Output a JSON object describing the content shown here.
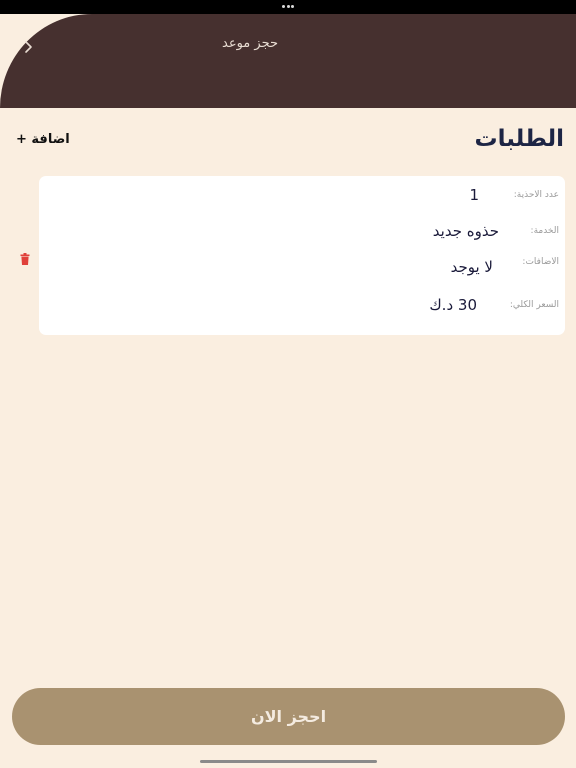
{
  "header": {
    "title": "حجز موعد",
    "back_icon": "chevron-right-icon"
  },
  "section": {
    "title": "الطلبات",
    "add_label": "اضافة +"
  },
  "order": {
    "shoes_count_label": "عدد الاحذية:",
    "shoes_count_value": "1",
    "service_label": "الخدمة:",
    "service_value": "حذوه جديد",
    "extras_label": "الاضافات:",
    "extras_value": "لا يوجد",
    "total_label": "السعر الكلي:",
    "total_value": "30 د.ك",
    "delete_icon": "trash-icon"
  },
  "footer": {
    "book_label": "احجز الان"
  },
  "colors": {
    "background": "#faeee0",
    "header": "#46302f",
    "title": "#1d2545",
    "button": "#a99270",
    "delete": "#e0403a"
  }
}
